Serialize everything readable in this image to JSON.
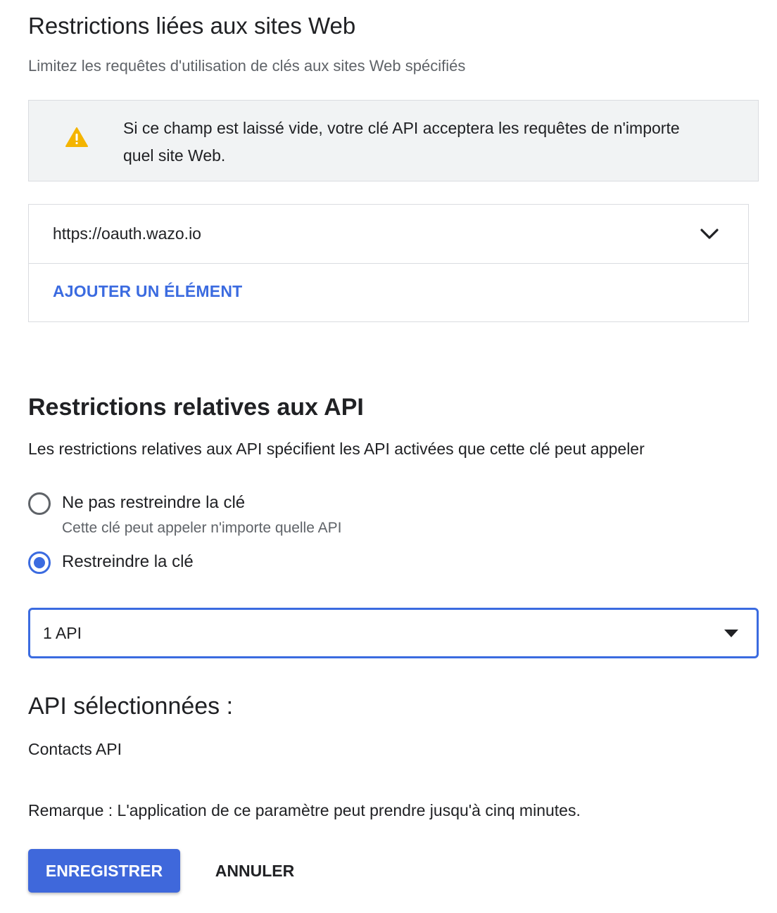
{
  "web_restrictions": {
    "title": "Restrictions liées aux sites Web",
    "subtitle": "Limitez les requêtes d'utilisation de clés aux sites Web spécifiés",
    "warning": {
      "icon": "warning-icon",
      "text": "Si ce champ est laissé vide, votre clé API acceptera les requêtes de n'importe quel site Web."
    },
    "referrers": [
      "https://oauth.wazo.io"
    ],
    "add_item_label": "AJOUTER UN ÉLÉMENT"
  },
  "api_restrictions": {
    "title": "Restrictions relatives aux API",
    "subtitle": "Les restrictions relatives aux API spécifient les API activées que cette clé peut appeler",
    "options": [
      {
        "label": "Ne pas restreindre la clé",
        "help": "Cette clé peut appeler n'importe quelle API",
        "checked": false
      },
      {
        "label": "Restreindre la clé",
        "help": "",
        "checked": true
      }
    ],
    "select_value": "1 API"
  },
  "selected_apis": {
    "title": "API sélectionnées :",
    "items": [
      "Contacts API"
    ]
  },
  "note": "Remarque : L'application de ce paramètre peut prendre jusqu'à cinq minutes.",
  "actions": {
    "save_label": "ENREGISTRER",
    "cancel_label": "ANNULER"
  },
  "colors": {
    "accent": "#3b6be0",
    "warning": "#f4b400",
    "banner_bg": "#f1f3f4"
  }
}
